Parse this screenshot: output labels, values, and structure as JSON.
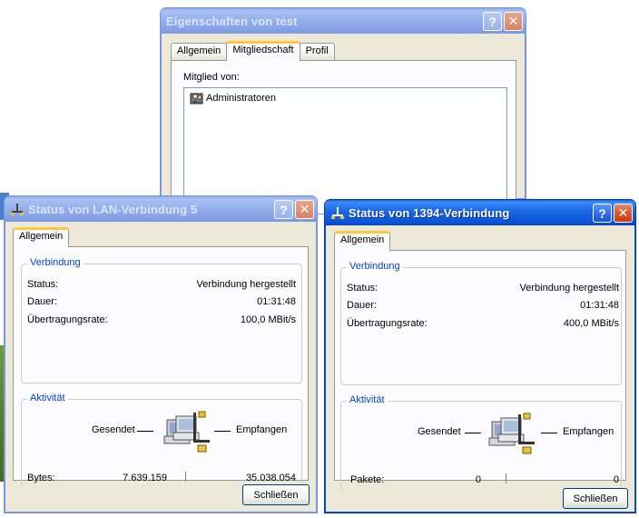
{
  "window_eigenschaften": {
    "title": "Eigenschaften von test",
    "tabs": [
      "Allgemein",
      "Mitgliedschaft",
      "Profil"
    ],
    "active_tab": "Mitgliedschaft",
    "member_of_label": "Mitglied von:",
    "members": [
      "Administratoren"
    ]
  },
  "window_lan": {
    "title": "Status von LAN-Verbindung 5",
    "tab": "Allgemein",
    "connection_group": "Verbindung",
    "status_label": "Status:",
    "status_value": "Verbindung hergestellt",
    "duration_label": "Dauer:",
    "duration_value": "01:31:48",
    "rate_label": "Übertragungsrate:",
    "rate_value": "100,0 MBit/s",
    "activity_group": "Aktivität",
    "sent_label": "Gesendet",
    "received_label": "Empfangen",
    "count_label": "Bytes:",
    "sent_value": "7.639.159",
    "received_value": "35.038.054",
    "close_button": "Schließen"
  },
  "window_1394": {
    "title": "Status von 1394-Verbindung",
    "tab": "Allgemein",
    "connection_group": "Verbindung",
    "status_label": "Status:",
    "status_value": "Verbindung hergestellt",
    "duration_label": "Dauer:",
    "duration_value": "01:31:48",
    "rate_label": "Übertragungsrate:",
    "rate_value": "400,0 MBit/s",
    "activity_group": "Aktivität",
    "sent_label": "Gesendet",
    "received_label": "Empfangen",
    "count_label": "Pakete:",
    "sent_value": "0",
    "received_value": "0",
    "close_button": "Schließen"
  },
  "icons": {
    "title_icon": "network-connection-icon",
    "member_icon": "user-group-icon",
    "activity_icon": "network-computers-icon",
    "help_button": "help-icon",
    "close_button": "close-icon"
  }
}
